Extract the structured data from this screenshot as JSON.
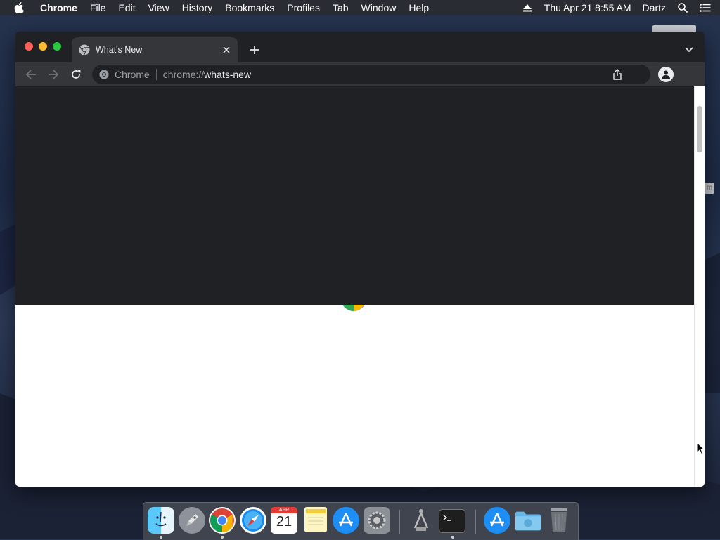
{
  "menubar": {
    "app_name": "Chrome",
    "items": [
      "File",
      "Edit",
      "View",
      "History",
      "Bookmarks",
      "Profiles",
      "Tab",
      "Window",
      "Help"
    ],
    "datetime": "Thu Apr 21  8:55 AM",
    "user": "Dartz"
  },
  "browser": {
    "tab_title": "What's New",
    "omnibox": {
      "chip": "Chrome",
      "url_scheme": "chrome://",
      "url_host": "whats-new"
    }
  },
  "dock": {
    "calendar_month": "APR",
    "calendar_day": "21",
    "apps": [
      "Finder",
      "Launchpad",
      "Google Chrome",
      "Safari",
      "Calendar",
      "Notes",
      "App Store",
      "System Preferences",
      "Automator",
      "Terminal",
      "App Store",
      "Downloads",
      "Trash"
    ]
  },
  "colors": {
    "menubar_bg": "#2a2c33",
    "tabstrip_bg": "#202124",
    "toolbar_bg": "#35363a",
    "content_dark": "#202124",
    "content_light": "#ffffff"
  }
}
